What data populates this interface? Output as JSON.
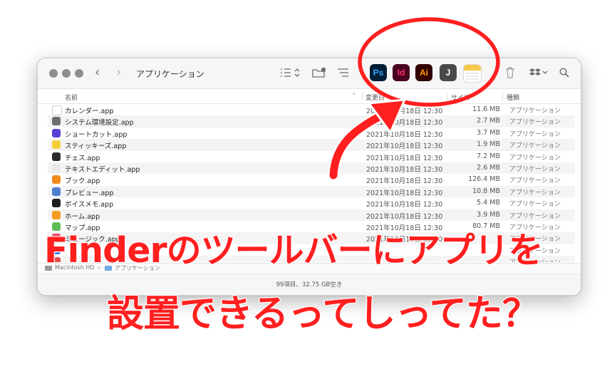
{
  "window": {
    "title": "アプリケーション",
    "nav_back": "‹",
    "nav_forward": "›"
  },
  "toolbar_apps": [
    {
      "label": "Ps",
      "fg": "#31a8ff",
      "bg": "#001e36"
    },
    {
      "label": "Id",
      "fg": "#ff3366",
      "bg": "#49021f"
    },
    {
      "label": "Ai",
      "fg": "#ff9a00",
      "bg": "#330000"
    },
    {
      "label": "J",
      "fg": "#ffffff",
      "bg": "#4a4a4a"
    }
  ],
  "columns": {
    "name": "名前",
    "date": "変更日",
    "size": "サイズ",
    "kind": "種類"
  },
  "files": [
    {
      "name": "カレンダー.app",
      "date": "2021年10月18日 12:30",
      "size": "11.6 MB",
      "kind": "アプリケーション",
      "icon": "calendar-icon",
      "color": "#ffffff"
    },
    {
      "name": "システム環境設定.app",
      "date": "2021年10月18日 12:30",
      "size": "2.7 MB",
      "kind": "アプリケーション",
      "icon": "gear-icon",
      "color": "#6e6e6e"
    },
    {
      "name": "ショートカット.app",
      "date": "2021年10月18日 12:30",
      "size": "3.7 MB",
      "kind": "アプリケーション",
      "icon": "shortcuts-icon",
      "color": "#5b3fd6"
    },
    {
      "name": "スティッキーズ.app",
      "date": "2021年10月18日 12:30",
      "size": "1.9 MB",
      "kind": "アプリケーション",
      "icon": "stickies-icon",
      "color": "#f5d03b"
    },
    {
      "name": "チェス.app",
      "date": "2021年10月18日 12:30",
      "size": "7.2 MB",
      "kind": "アプリケーション",
      "icon": "chess-icon",
      "color": "#2b2b2b"
    },
    {
      "name": "テキストエディット.app",
      "date": "2021年10月18日 12:30",
      "size": "2.6 MB",
      "kind": "アプリケーション",
      "icon": "textedit-icon",
      "color": "#e9e9e9"
    },
    {
      "name": "ブック.app",
      "date": "2021年10月18日 12:30",
      "size": "126.4 MB",
      "kind": "アプリケーション",
      "icon": "books-icon",
      "color": "#f08a1c"
    },
    {
      "name": "プレビュー.app",
      "date": "2021年10月18日 12:30",
      "size": "10.8 MB",
      "kind": "アプリケーション",
      "icon": "preview-icon",
      "color": "#4b7fd1"
    },
    {
      "name": "ボイスメモ.app",
      "date": "2021年10月18日 12:30",
      "size": "5.4 MB",
      "kind": "アプリケーション",
      "icon": "voice-memo-icon",
      "color": "#1e1e1e"
    },
    {
      "name": "ホーム.app",
      "date": "2021年10月18日 12:30",
      "size": "3.9 MB",
      "kind": "アプリケーション",
      "icon": "home-icon",
      "color": "#f59a23"
    },
    {
      "name": "マップ.app",
      "date": "2021年10月18日 12:30",
      "size": "80.7 MB",
      "kind": "アプリケーション",
      "icon": "maps-icon",
      "color": "#5cbf5a"
    },
    {
      "name": "ミュージック.app",
      "date": "2021年10月18日 12:30",
      "size": "",
      "kind": "アプリケーション",
      "icon": "music-icon",
      "color": "#f23b57"
    },
    {
      "name": "",
      "date": "",
      "size": "",
      "kind": "アプリケーション",
      "icon": "app-icon",
      "color": "#3478f6"
    },
    {
      "name": "",
      "date": "",
      "size": "",
      "kind": "アプリケーション",
      "icon": "app-icon",
      "color": "#e34b4b"
    }
  ],
  "pathbar": {
    "disk": "Macintosh HD",
    "separator": "›",
    "folder": "アプリケーション"
  },
  "status": "99項目、32.75 GB空き",
  "overlay": {
    "line1": "Finderのツールバーにアプリを",
    "line2": "設置できるってしってた？",
    "color": "#ff1f1f"
  }
}
